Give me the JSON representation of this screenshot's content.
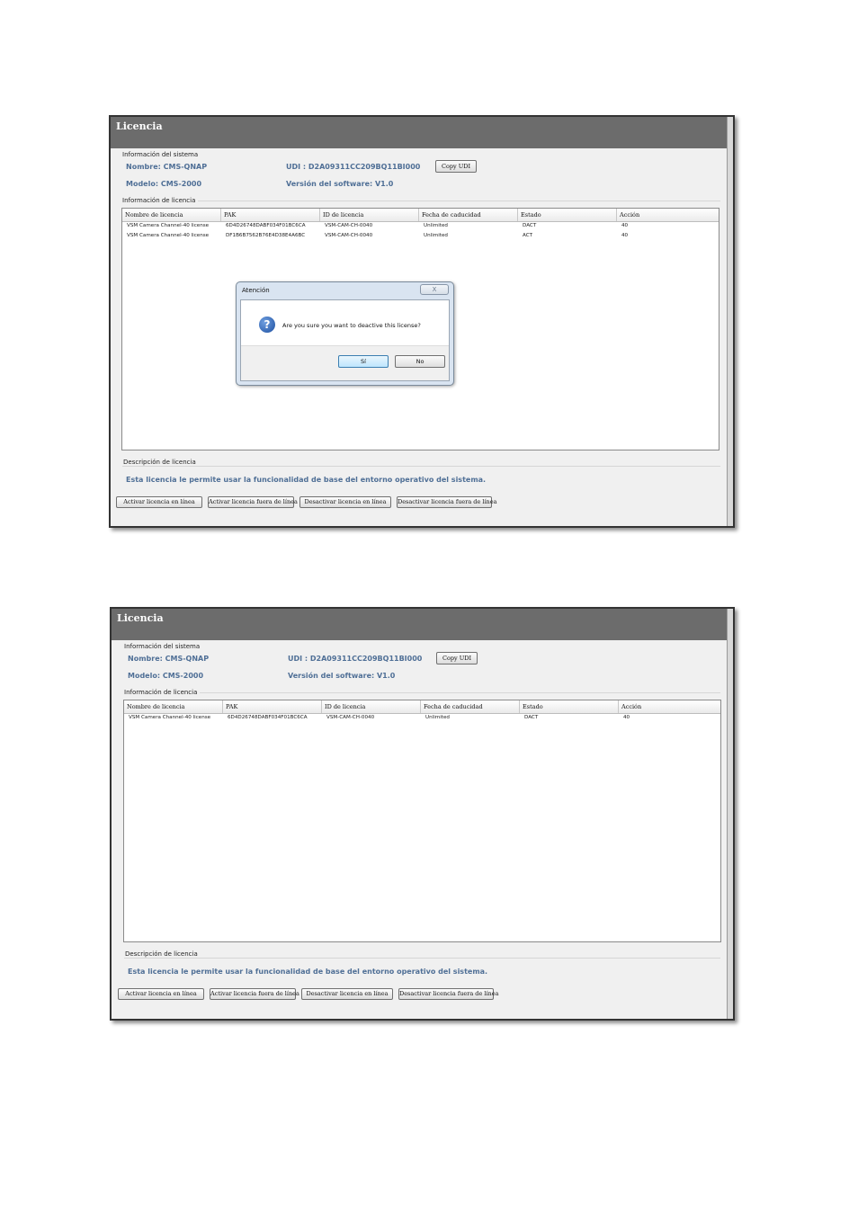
{
  "screens": [
    {
      "title": "Licencia",
      "system_info": {
        "group_label": "Información del sistema",
        "nombre": "Nombre: CMS-QNAP",
        "modelo": "Modelo: CMS-2000",
        "udi": "UDI : D2A09311CC209BQ11BI000",
        "version": "Versión del software: V1.0",
        "copy_udi_label": "Copy UDI"
      },
      "license_info": {
        "group_label": "Información de licencia",
        "columns": [
          "Nombre de licencia",
          "PAK",
          "ID de licencia",
          "Fecha de caducidad",
          "Estado",
          "Acción"
        ],
        "rows": [
          [
            "VSM Camera Channel-40 license",
            "6D4D26748DABF034F01BC6CA",
            "VSM-CAM-CH-0040",
            "Unlimited",
            "DACT",
            "40"
          ],
          [
            "VSM Camera Channel-40 license",
            "DF1B6B7562B76E4D38E4A6BC",
            "VSM-CAM-CH-0040",
            "Unlimited",
            "ACT",
            "40"
          ]
        ]
      },
      "description": {
        "group_label": "Descripción de licencia",
        "text": "Esta licencia le permite usar la funcionalidad de base del entorno operativo del sistema."
      },
      "buttons": [
        "Activar licencia en línea",
        "Activar licencia fuera de línea",
        "Desactivar licencia en línea",
        "Desactivar licencia fuera de línea"
      ],
      "dialog": {
        "title": "Atención",
        "close_glyph": "X",
        "icon": "question-icon",
        "message": "Are you sure you want to deactive this license?",
        "yes_label": "Sí",
        "no_label": "No"
      }
    },
    {
      "title": "Licencia",
      "system_info": {
        "group_label": "Información del sistema",
        "nombre": "Nombre: CMS-QNAP",
        "modelo": "Modelo: CMS-2000",
        "udi": "UDI : D2A09311CC209BQ11BI000",
        "version": "Versión del software: V1.0",
        "copy_udi_label": "Copy UDI"
      },
      "license_info": {
        "group_label": "Información de licencia",
        "columns": [
          "Nombre de licencia",
          "PAK",
          "ID de licencia",
          "Fecha de caducidad",
          "Estado",
          "Acción"
        ],
        "rows": [
          [
            "VSM Camera Channel-40 license",
            "6D4D26748DABF034F01BC6CA",
            "VSM-CAM-CH-0040",
            "Unlimited",
            "DACT",
            "40"
          ]
        ]
      },
      "description": {
        "group_label": "Descripción de licencia",
        "text": "Esta licencia le permite usar la funcionalidad de base del entorno operativo del sistema."
      },
      "buttons": [
        "Activar licencia en línea",
        "Activar licencia fuera de línea",
        "Desactivar licencia en línea",
        "Desactivar licencia fuera de línea"
      ]
    }
  ]
}
